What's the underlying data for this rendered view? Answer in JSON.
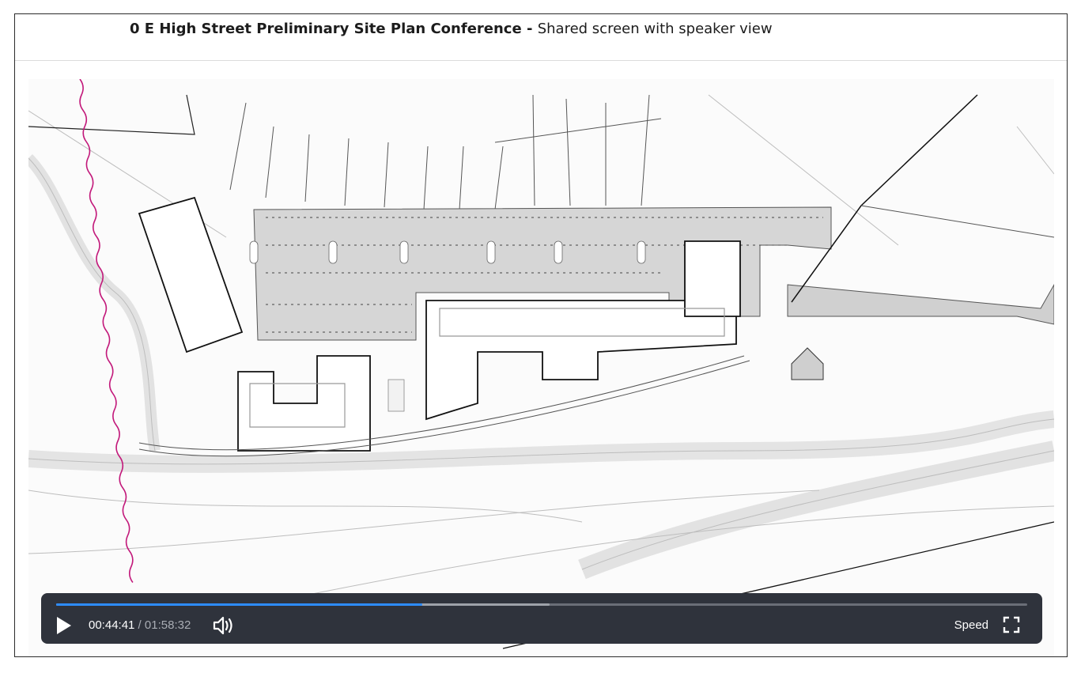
{
  "header": {
    "title_strong": "0 E High Street Preliminary Site Plan Conference",
    "separator": " - ",
    "title_rest": "Shared screen with speaker view"
  },
  "player": {
    "current_time": "00:44:41",
    "time_separator": " / ",
    "duration": "01:58:32",
    "speed_label": "Speed",
    "progress_fraction": 0.377,
    "buffered_fraction": 0.508,
    "accent_color": "#2d8cff"
  },
  "icons": {
    "play": "play-icon",
    "volume": "volume-icon",
    "fullscreen": "fullscreen-icon"
  }
}
